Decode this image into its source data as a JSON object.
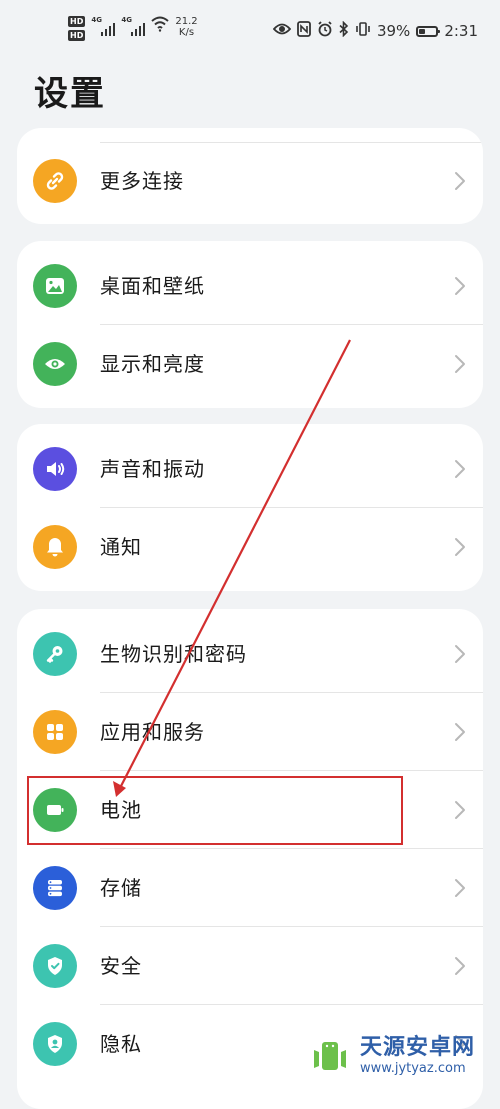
{
  "status_bar": {
    "hd1": "HD",
    "hd2": "HD",
    "net1": "4G",
    "net2": "4G",
    "speed_value": "21.2",
    "speed_unit": "K/s",
    "battery_percent": "39%",
    "time": "2:31",
    "icons": [
      "eye-icon",
      "nfc-icon",
      "alarm-icon",
      "bluetooth-icon",
      "vibrate-icon",
      "battery-icon"
    ]
  },
  "page": {
    "title": "设置"
  },
  "cards": [
    {
      "items": [
        {
          "label": "更多连接",
          "icon": "link-icon",
          "color": "#f5a623"
        }
      ]
    },
    {
      "items": [
        {
          "label": "桌面和壁纸",
          "icon": "wallpaper-icon",
          "color": "#43b35a"
        },
        {
          "label": "显示和亮度",
          "icon": "eye-icon",
          "color": "#43b35a"
        }
      ]
    },
    {
      "items": [
        {
          "label": "声音和振动",
          "icon": "speaker-icon",
          "color": "#5b4fe0"
        },
        {
          "label": "通知",
          "icon": "bell-icon",
          "color": "#f5a623"
        }
      ]
    },
    {
      "items": [
        {
          "label": "生物识别和密码",
          "icon": "key-icon",
          "color": "#3dc4b0"
        },
        {
          "label": "应用和服务",
          "icon": "apps-icon",
          "color": "#f5a623"
        },
        {
          "label": "电池",
          "icon": "battery-icon",
          "color": "#43b35a"
        },
        {
          "label": "存储",
          "icon": "storage-icon",
          "color": "#2b5fd9"
        },
        {
          "label": "安全",
          "icon": "shield-icon",
          "color": "#3dc4b0"
        },
        {
          "label": "隐私",
          "icon": "privacy-icon",
          "color": "#3dc4b0"
        }
      ]
    }
  ],
  "annotation": {
    "color": "#d32f2f"
  },
  "watermark": {
    "name": "天源安卓网",
    "url": "www.jytyaz.com"
  }
}
